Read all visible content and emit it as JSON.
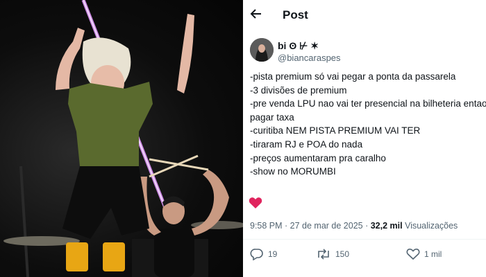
{
  "header": {
    "title": "Post"
  },
  "author": {
    "display_name": "bi ʘ ⊬ ✶",
    "handle": "@biancaraspes"
  },
  "post": {
    "lines": [
      "-pista premium só vai pegar a ponta da passarela",
      "-3 divisões de premium",
      "-pre venda LPU nao vai ter presencial na bilheteria entao vai",
      "pagar taxa",
      "-curitiba NEM PISTA PREMIUM VAI TER",
      "-tiraram RJ e POA do nada",
      "-preços aumentaram pra caralho",
      "-show no MORUMBI"
    ],
    "time": "9:58 PM",
    "sep": " · ",
    "date": "27 de mar de 2025",
    "views_count": "32,2 mil",
    "views_label": "Visualizações"
  },
  "actions": {
    "replies": "19",
    "reposts": "150",
    "likes": "1 mil"
  },
  "icons": {
    "back": "arrow-left-icon",
    "heart": "heart-icon",
    "reply": "reply-icon",
    "repost": "repost-icon",
    "like": "like-icon"
  },
  "colors": {
    "heart": "#e0245e",
    "muted": "#536471",
    "text": "#0f1419",
    "light_beam": "#d86bff"
  }
}
